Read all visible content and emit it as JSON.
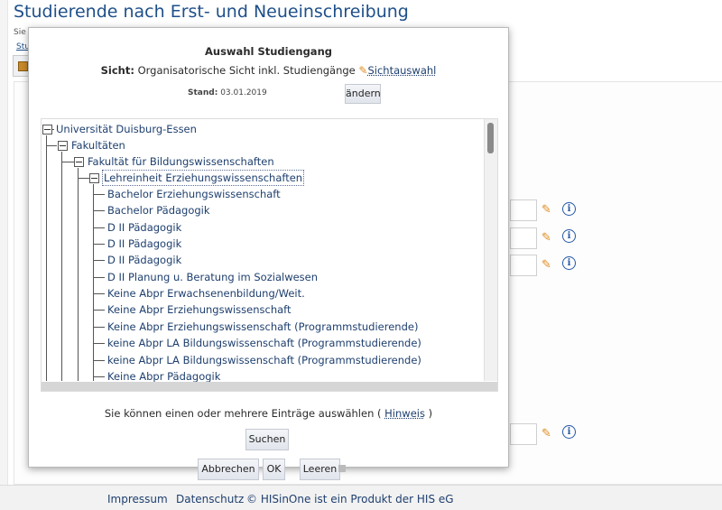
{
  "page": {
    "title": "Studierende nach Erst- und Neueinschreibung",
    "fragment_1": "Sie",
    "fragment_2": "Stu"
  },
  "dialog": {
    "title": "Auswahl Studiengang",
    "view_label": "Sicht:",
    "view_value": "Organisatorische Sicht inkl. Studiengänge",
    "view_link": "Sichtauswahl",
    "stand_label": "Stand:",
    "stand_value": "03.01.2019",
    "change_button": "ändern",
    "tree": {
      "root": "Universität Duisburg-Essen",
      "level1": "Fakultäten",
      "level2": "Fakultät für Bildungswissenschaften",
      "level3": "Lehreinheit Erziehungswissenschaften",
      "items": [
        "Bachelor Erziehungswissenschaft",
        "Bachelor Pädagogik",
        "D II Pädagogik",
        "D II Pädagogik",
        "D II Pädagogik",
        "D II Planung u. Beratung im Sozialwesen",
        "Keine Abpr Erwachsenenbildung/Weit.",
        "Keine Abpr Erziehungswissenschaft",
        "Keine Abpr Erziehungswissenschaft (Programmstudierende)",
        "keine Abpr LA Bildungswissenschaft (Programmstudierende)",
        "keine Abpr LA Bildungswissenschaft (Programmstudierende)",
        "Keine Abpr Pädagogik"
      ]
    },
    "hint_prefix": "Sie können einen oder mehrere Einträge auswählen (",
    "hint_link": "Hinweis",
    "hint_suffix": ")",
    "search_button": "Suchen",
    "cancel_button": "Abbrechen",
    "ok_button": "OK",
    "clear_button": "Leeren"
  },
  "footer": {
    "impressum": "Impressum",
    "datenschutz": "Datenschutz",
    "copyright": "© HISinOne ist ein Produkt der HIS eG"
  }
}
